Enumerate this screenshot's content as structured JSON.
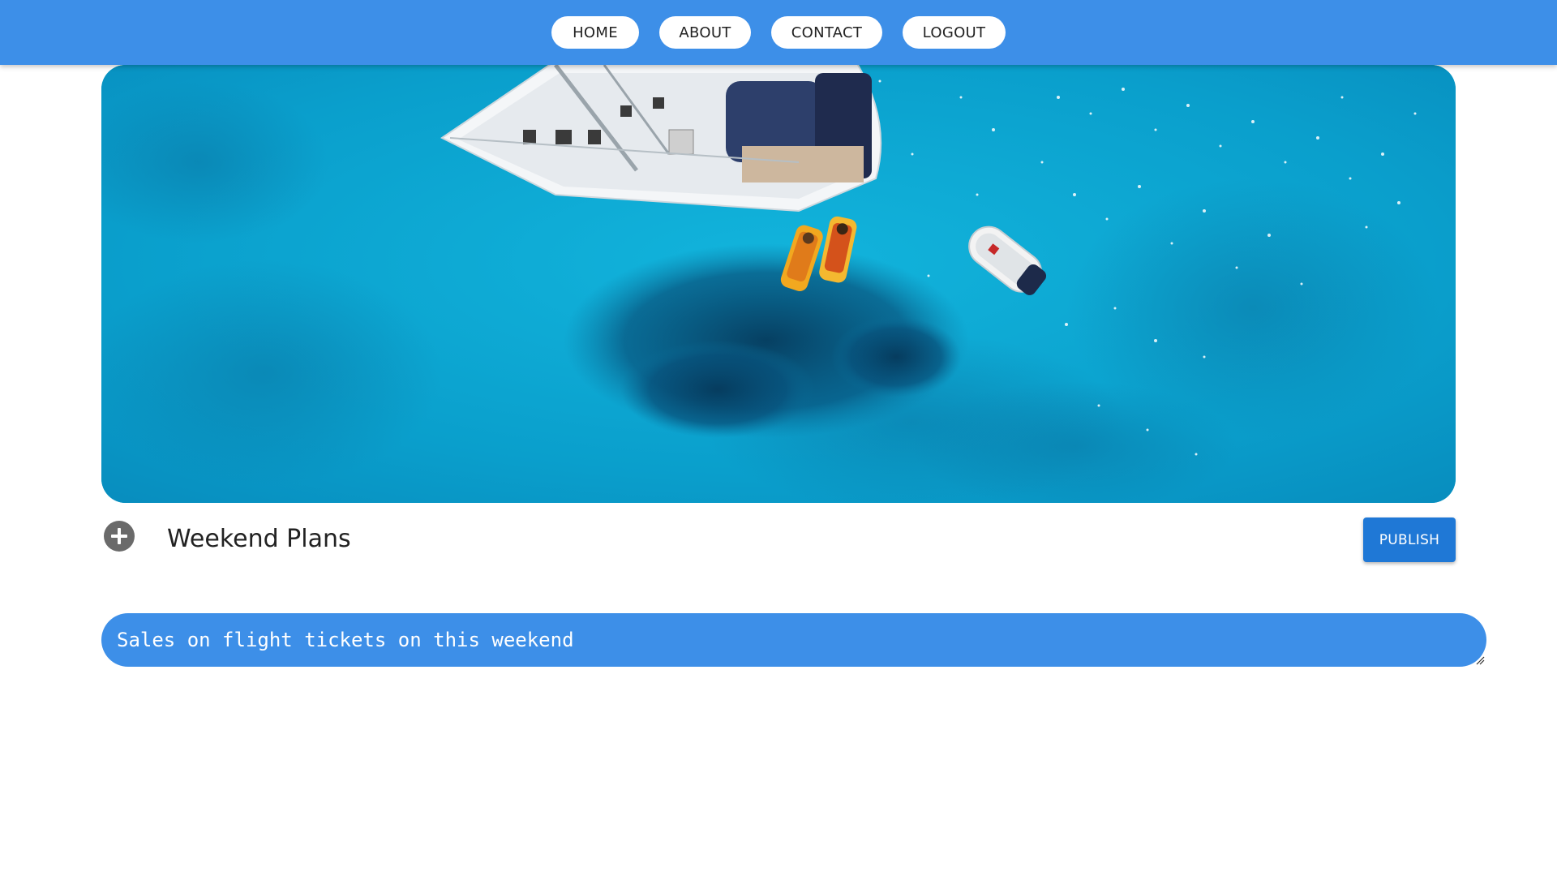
{
  "nav": {
    "items": [
      {
        "label": "HOME"
      },
      {
        "label": "ABOUT"
      },
      {
        "label": "CONTACT"
      },
      {
        "label": "LOGOUT"
      }
    ]
  },
  "post": {
    "title": "Weekend Plans",
    "publish_label": "PUBLISH",
    "body": "Sales on flight tickets on this weekend"
  },
  "colors": {
    "nav_bar": "#3d8fe8",
    "publish_button": "#1f78d6",
    "text_area": "#3d8fe8",
    "add_button": "#6a6a6a"
  },
  "icons": {
    "add": "plus-circle-icon",
    "resize": "resize-handle-icon"
  }
}
